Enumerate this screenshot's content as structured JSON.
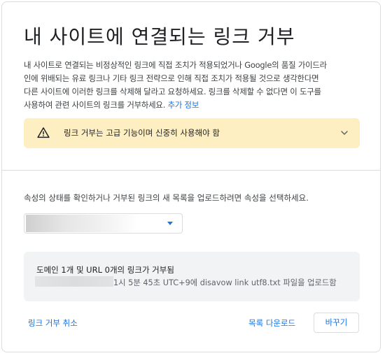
{
  "dialog": {
    "title": "내 사이트에 연결되는 링크 거부",
    "description_lines": [
      "내 사이트로 연결되는 비정상적인 링크에 직접 조치가 적용되었거나 Google의 품질 가이드라",
      "인에 위배되는 유료 링크나 기타 링크 전략으로 인해 직접 조치가 적용될 것으로 생각한다면",
      "다른 사이트에 이러한 링크를 삭제해 달라고 요청하세요. 링크를 삭제할 수 없다면 이 도구를",
      "사용하여 관련 사이트의 링크를 거부하세요."
    ],
    "learn_more": "추가 정보"
  },
  "warning": {
    "text": "링크 거부는 고급 기능이며 신중히 사용해야 함",
    "icon": "warning-triangle-icon",
    "expand_icon": "chevron-down-icon"
  },
  "property": {
    "prompt": "속성의 상태를 확인하거나 거부된 링크의 새 목록을 업로드하려면 속성을 선택하세요.",
    "selected_value": ""
  },
  "status": {
    "line1": "도메인 1개 및 URL 0개의 링크가 거부됨",
    "line2": "1시 5분 45초 UTC+9에 disavow link utf8.txt 파일을 업로드함"
  },
  "actions": {
    "cancel": "링크 거부 취소",
    "download": "목록 다운로드",
    "change": "바꾸기"
  },
  "colors": {
    "accent": "#1a73e8",
    "warning_bg": "#feefc3",
    "status_bg": "#f1f3f4"
  }
}
